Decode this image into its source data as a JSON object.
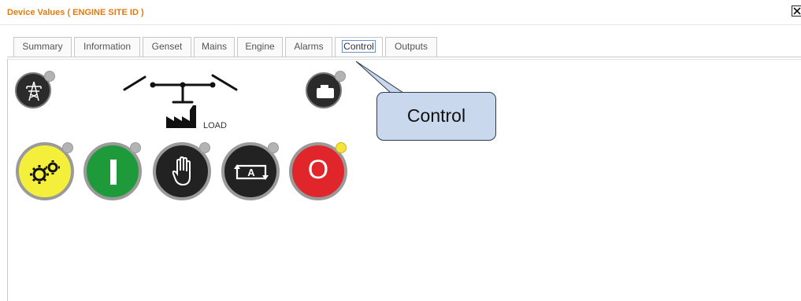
{
  "window": {
    "title": "Device Values ( ENGINE SITE ID )",
    "close_icon": "close-x-icon"
  },
  "tabs": [
    {
      "label": "Summary",
      "active": false
    },
    {
      "label": "Information",
      "active": false
    },
    {
      "label": "Genset",
      "active": false
    },
    {
      "label": "Mains",
      "active": false
    },
    {
      "label": "Engine",
      "active": false
    },
    {
      "label": "Alarms",
      "active": false
    },
    {
      "label": "Control",
      "active": true
    },
    {
      "label": "Outputs",
      "active": false
    }
  ],
  "diagram": {
    "mains_icon": "transmission-tower-icon",
    "genset_icon": "generator-icon",
    "load_icon": "factory-icon",
    "load_label": "LOAD"
  },
  "controls": [
    {
      "name": "test-button",
      "icon": "gears-icon",
      "color": "#f4ef3b",
      "indicator": "gray"
    },
    {
      "name": "start-button",
      "icon": "on-bar-icon",
      "color": "#1f9a3b",
      "indicator": "gray"
    },
    {
      "name": "manual-button",
      "icon": "hand-icon",
      "color": "#222222",
      "indicator": "gray"
    },
    {
      "name": "auto-button",
      "icon": "auto-a-icon",
      "color": "#222222",
      "indicator": "gray"
    },
    {
      "name": "stop-button",
      "icon": "off-o-icon",
      "color": "#e0262b",
      "indicator": "yellow",
      "symbol": "O"
    }
  ],
  "tooltip": {
    "text": "Control"
  },
  "colors": {
    "title": "#e07b10",
    "tooltip_bg": "#c9d8ec",
    "indicator_gray": "#b3b3b3",
    "indicator_yellow": "#f5e23a"
  }
}
